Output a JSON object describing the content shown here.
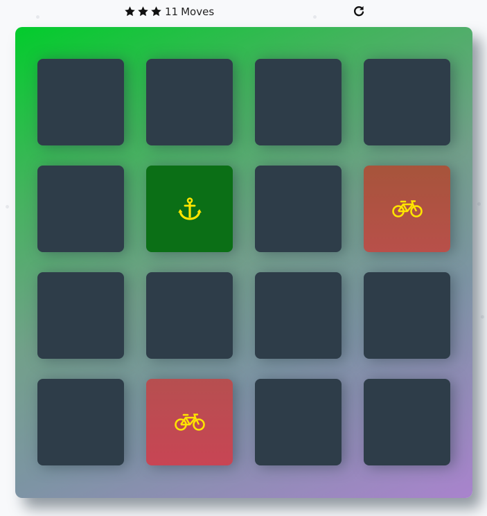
{
  "score_panel": {
    "stars": [
      {
        "icon": "star-icon"
      },
      {
        "icon": "star-icon"
      },
      {
        "icon": "star-icon"
      }
    ],
    "moves_count": "11",
    "moves_label": "Moves",
    "restart_icon": "refresh-icon"
  },
  "deck": {
    "rows": 4,
    "columns": 4,
    "cards": [
      {
        "state": "closed",
        "symbol": null
      },
      {
        "state": "closed",
        "symbol": null
      },
      {
        "state": "closed",
        "symbol": null
      },
      {
        "state": "closed",
        "symbol": null
      },
      {
        "state": "closed",
        "symbol": null
      },
      {
        "state": "match",
        "symbol": "anchor-icon"
      },
      {
        "state": "closed",
        "symbol": null
      },
      {
        "state": "open",
        "symbol": "bicycle-icon"
      },
      {
        "state": "closed",
        "symbol": null
      },
      {
        "state": "closed",
        "symbol": null
      },
      {
        "state": "closed",
        "symbol": null
      },
      {
        "state": "closed",
        "symbol": null
      },
      {
        "state": "closed",
        "symbol": null
      },
      {
        "state": "open",
        "symbol": "bicycle-icon"
      },
      {
        "state": "closed",
        "symbol": null
      },
      {
        "state": "closed",
        "symbol": null
      }
    ]
  },
  "colors": {
    "page_background": "#f8f9fb",
    "card_closed": "#2e3d49",
    "card_match": "#0b6f16",
    "card_open": "#c04a50",
    "symbol": "#ffe500"
  }
}
